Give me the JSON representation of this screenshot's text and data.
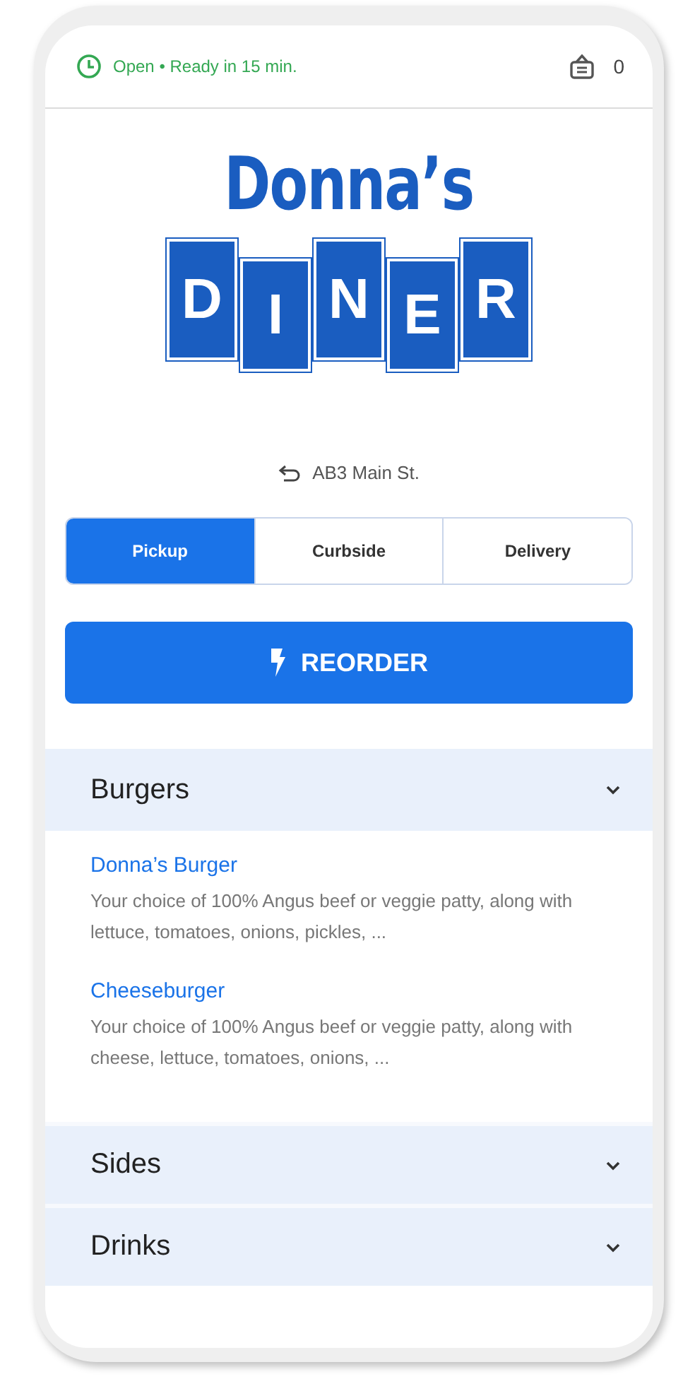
{
  "status": {
    "text": "Open • Ready in 15 min.",
    "cart_count": "0"
  },
  "logo": {
    "name": "Donna’s",
    "tiles": [
      "D",
      "I",
      "N",
      "E",
      "R"
    ]
  },
  "address": "AB3 Main St.",
  "tabs": [
    {
      "label": "Pickup",
      "selected": true
    },
    {
      "label": "Curbside",
      "selected": false
    },
    {
      "label": "Delivery",
      "selected": false
    }
  ],
  "reorder_button": "REORDER",
  "sections": [
    {
      "title": "Burgers",
      "items": [
        {
          "name": "Donna’s Burger",
          "description": "Your choice of 100% Angus beef or veggie patty, along with lettuce, tomatoes, onions, pickles, ..."
        },
        {
          "name": "Cheeseburger",
          "description": "Your choice of 100% Angus beef or veggie patty, along with cheese, lettuce, tomatoes, onions, ..."
        }
      ]
    },
    {
      "title": "Sides"
    },
    {
      "title": "Drinks"
    }
  ]
}
